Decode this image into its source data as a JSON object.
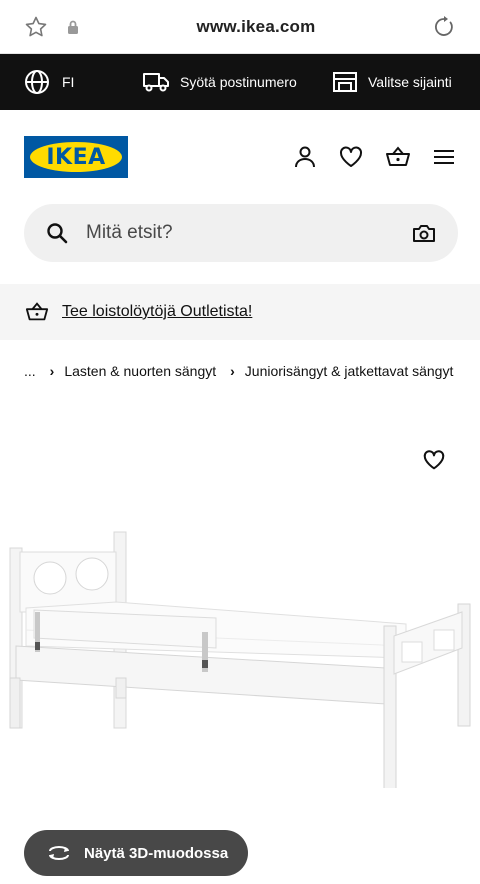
{
  "browser": {
    "url": "www.ikea.com"
  },
  "topbar": {
    "language": "FI",
    "postal_label": "Syötä postinumero",
    "store_label": "Valitse sijainti"
  },
  "brand": {
    "logo_text": "IKEA",
    "logo_blue": "#0058a3",
    "logo_yellow": "#ffdb00"
  },
  "search": {
    "placeholder": "Mitä etsit?"
  },
  "promo": {
    "text": "Tee loistolöytöjä Outletista!"
  },
  "breadcrumb": {
    "ellipsis": "...",
    "items": [
      "Lasten & nuorten sängyt",
      "Juniorisängyt & jatkettavat sängyt"
    ]
  },
  "product": {
    "view3d_label": "Näytä 3D-muodossa"
  },
  "icons": {
    "bookmark": "star-icon",
    "lock": "lock-icon",
    "reload": "reload-icon",
    "globe": "globe-icon",
    "truck": "truck-icon",
    "store": "store-icon",
    "account": "user-icon",
    "wishlist": "heart-icon",
    "cart": "basket-icon",
    "menu": "hamburger-icon",
    "search": "search-icon",
    "camera": "camera-icon",
    "rotate": "rotate-icon"
  }
}
